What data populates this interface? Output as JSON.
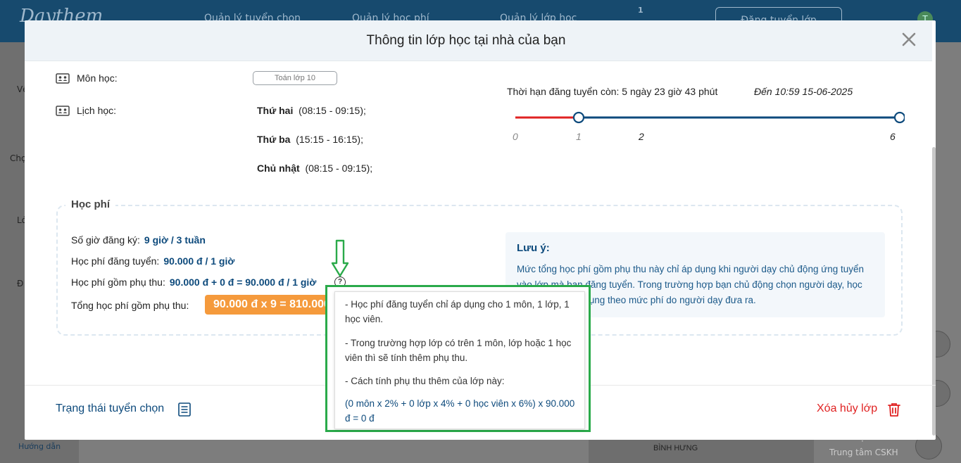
{
  "background": {
    "logo": "Daythem",
    "nav": [
      "Quản lý tuyển chọn",
      "Quản lý học phí",
      "Quản lý lớp học"
    ],
    "notif_count": "1",
    "cta": "Đăng tuyển lớp",
    "avatar_letter": "T",
    "side_labels": [
      "Về",
      "Chọ",
      "Lớ",
      "Đ"
    ],
    "guide": "Hướng dẫn",
    "support_title": "Liên hệ",
    "support_sub": "Trung tâm CSKH",
    "map_label": "BÌNH HƯNG"
  },
  "modal": {
    "title": "Thông tin lớp học tại nhà của bạn",
    "subject_label": "Môn học:",
    "subject_value": "Toán lớp 10",
    "schedule_label": "Lịch học:",
    "schedule": [
      {
        "day": "Thứ hai",
        "time": "(08:15 - 09:15);"
      },
      {
        "day": "Thứ ba",
        "time": "(15:15 - 16:15);"
      },
      {
        "day": "Chủ nhật",
        "time": "(08:15 - 09:15);"
      }
    ],
    "deadline_text": "Thời hạn đăng tuyển còn: 5 ngày 23 giờ 43 phút",
    "deadline_date": "Đến 10:59 15-06-2025",
    "timeline_labels": [
      "0",
      "1",
      "2",
      "6"
    ],
    "timeline_progress": 1,
    "timeline_max": 6,
    "fee_section_title": "Học phí",
    "fee_rows": {
      "hours_label": "Số giờ đăng ký:",
      "hours_value": "9 giờ / 3 tuần",
      "posted_label": "Học phí đăng tuyển:",
      "posted_value": "90.000 đ / 1 giờ",
      "surcharge_label": "Học phí gồm phụ thu:",
      "surcharge_value": "90.000 đ + 0 đ = 90.000 đ / 1 giờ",
      "total_label": "Tổng học phí gồm phụ thu:",
      "total_value": "90.000 đ x 9 = 810.000 đ"
    },
    "note_title": "Lưu ý:",
    "note_text": "Mức tổng học phí gồm phụ thu này chỉ áp dụng khi người dạy chủ động ứng tuyển vào lớp mà bạn đăng tuyển. Trong trường hợp bạn chủ động chọn người dạy, học phí sẽ được áp dụng theo mức phí do người dạy đưa ra.",
    "status_link": "Trạng thái tuyển chọn",
    "delete_link": "Xóa hủy lớp"
  },
  "tooltip": {
    "p1": "- Học phí đăng tuyển chỉ áp dụng cho 1 môn, 1 lớp, 1 học viên.",
    "p2": "- Trong trường hợp lớp có trên 1 môn, lớp hoặc 1 học viên thì sẽ tính thêm phụ thu.",
    "p3": "- Cách tính phụ thu thêm của lớp này:",
    "p4": "(0 môn x 2% + 0 lớp x 4% + 0 học viên x 6%) x 90.000 đ = 0 đ"
  },
  "colors": {
    "accent": "#0d4a7c",
    "timeline_elapsed": "#e02222",
    "total_badge": "#f59a3c",
    "delete": "#e02222",
    "highlight": "#2aaa4a"
  }
}
